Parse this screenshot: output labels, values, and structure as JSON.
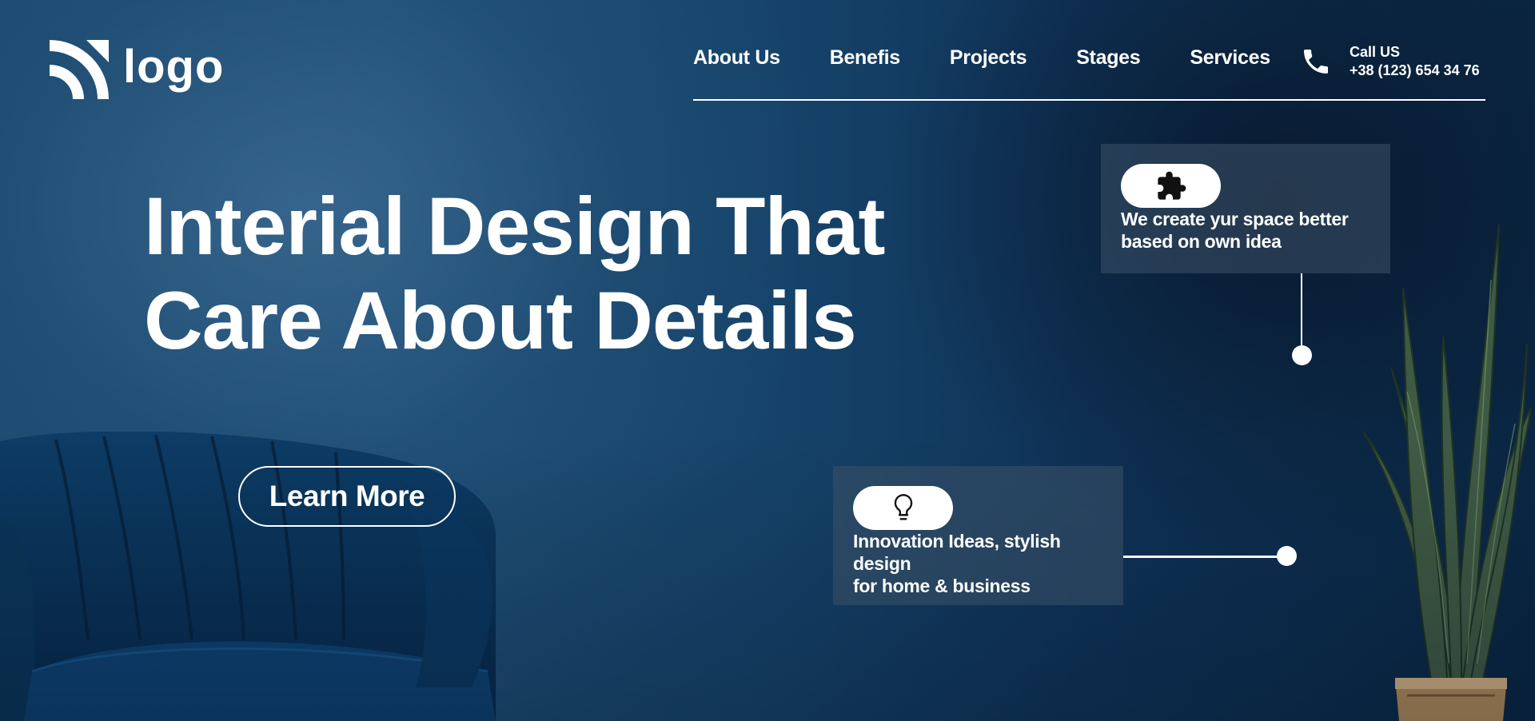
{
  "logo": {
    "text": "logo",
    "icon": "signal-arcs-logo-icon"
  },
  "nav": {
    "items": [
      {
        "label": "About Us"
      },
      {
        "label": "Benefis"
      },
      {
        "label": "Projects"
      },
      {
        "label": "Stages"
      },
      {
        "label": "Services"
      }
    ]
  },
  "contact": {
    "icon": "phone-icon",
    "label": "Call US",
    "phone": "+38 (123) 654 34 76"
  },
  "hero": {
    "title_line1": "Interial Design That",
    "title_line2": "Care About Details",
    "cta_label": "Learn More"
  },
  "cards": [
    {
      "icon": "puzzle-icon",
      "line1": "We create yur space better",
      "line2": "based on own idea"
    },
    {
      "icon": "lightbulb-icon",
      "line1": "Innovation Ideas, stylish",
      "line2": "design",
      "line3": "for home & business"
    }
  ],
  "colors": {
    "background": "#1c4a70",
    "text": "#ffffff",
    "card_bg": "#3c5268"
  }
}
